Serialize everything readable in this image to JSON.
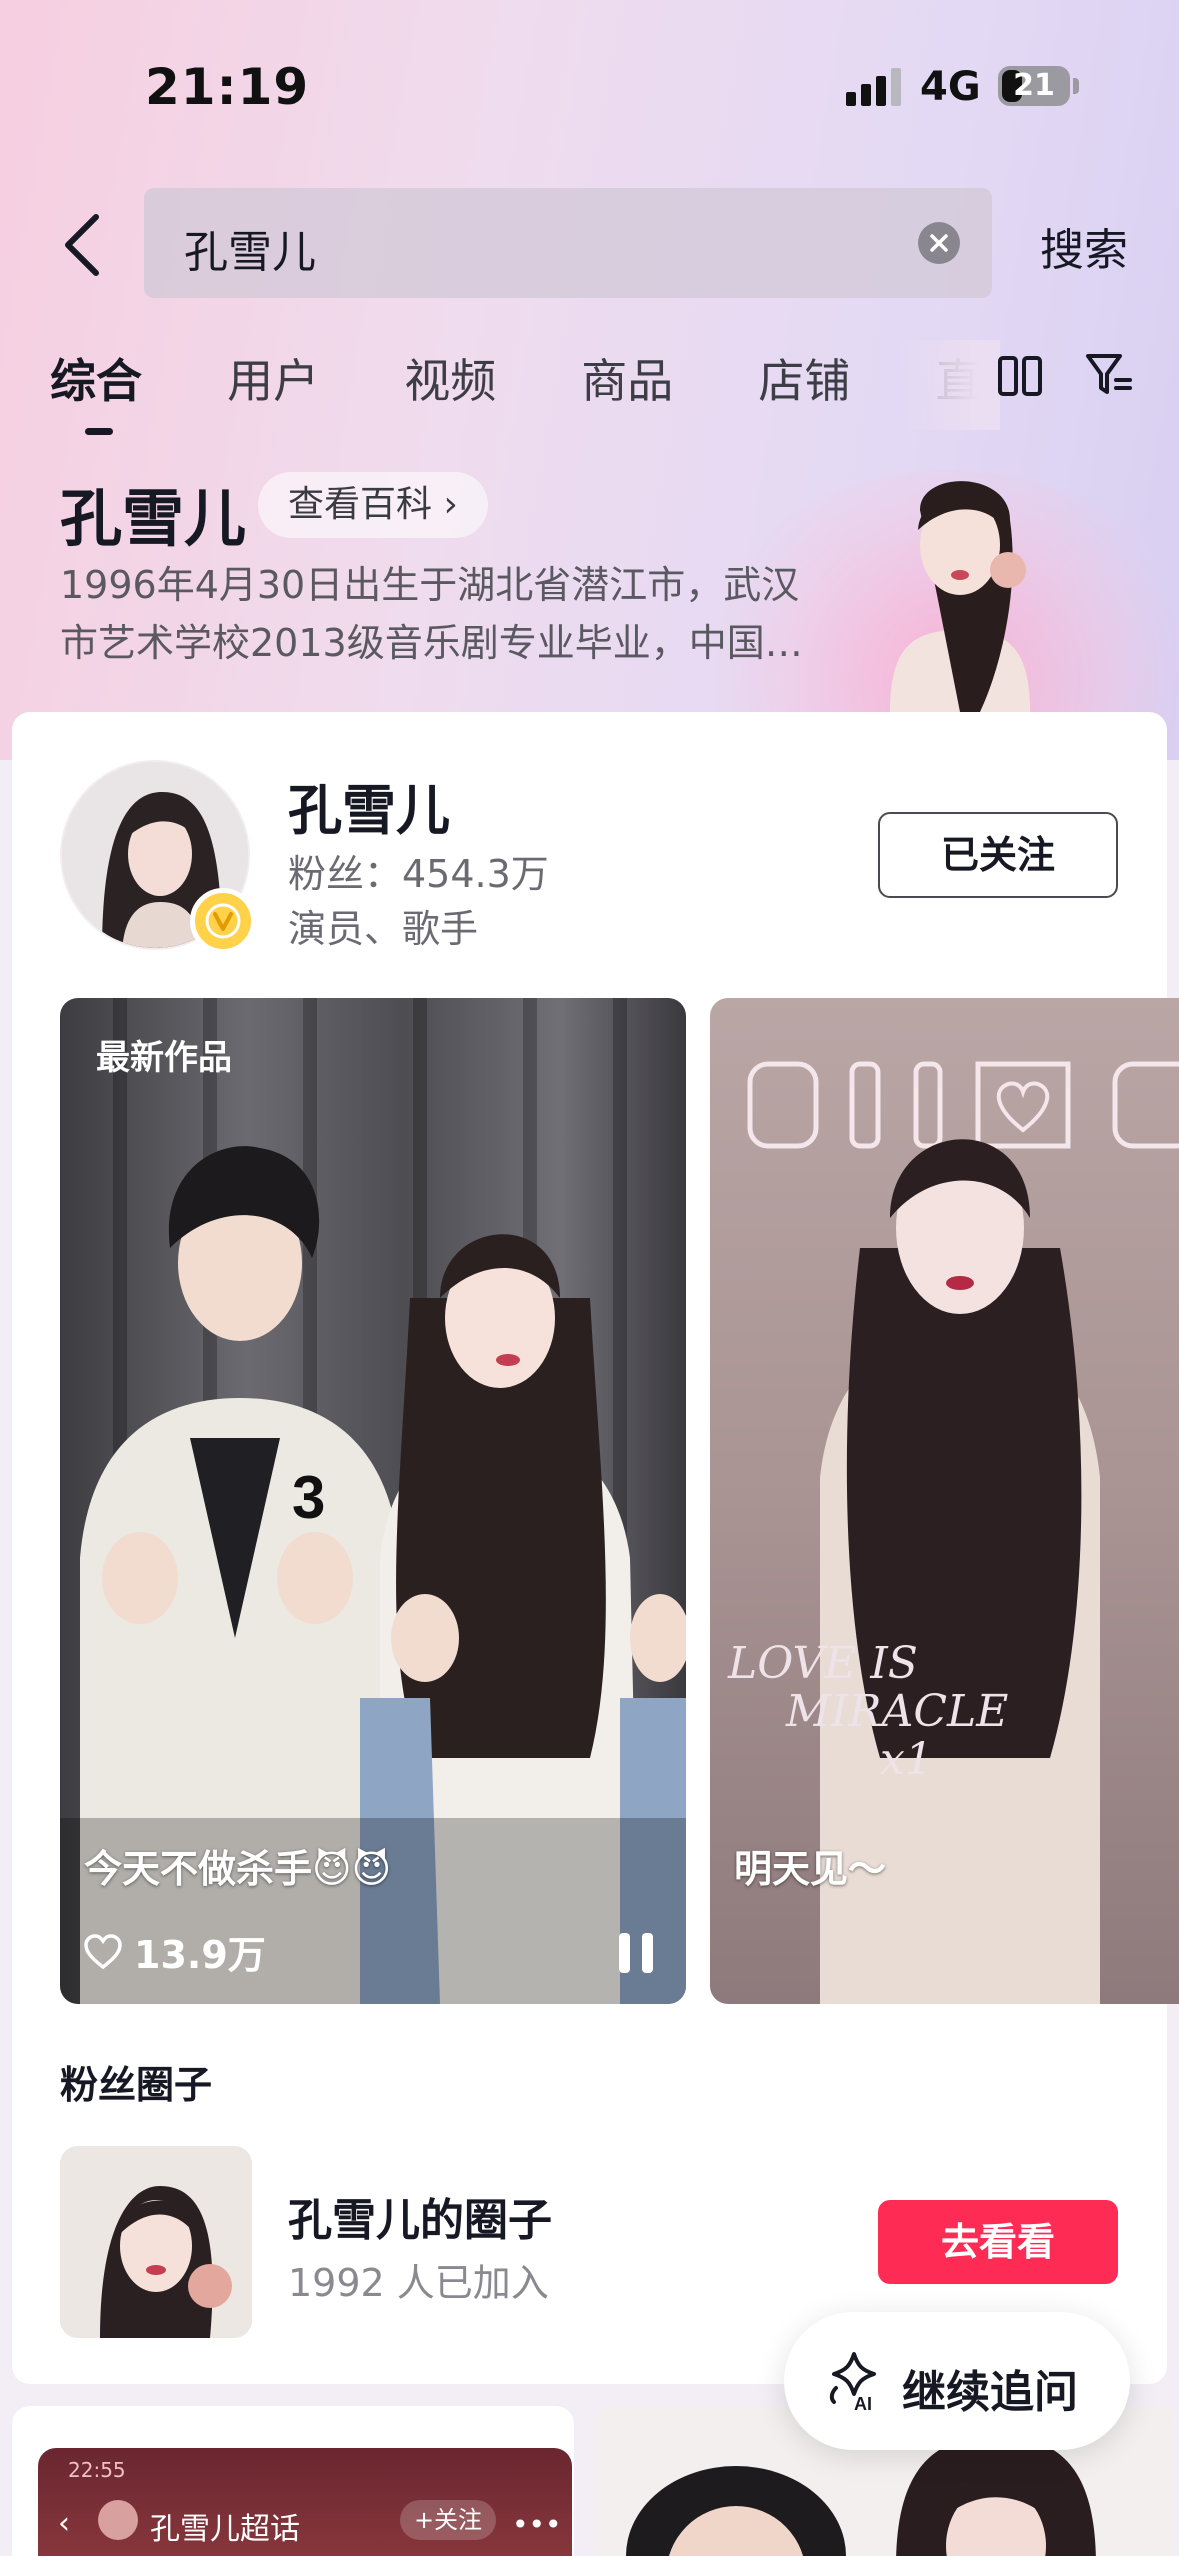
{
  "status_bar": {
    "time": "21:19",
    "network": "4G",
    "battery": "21"
  },
  "search": {
    "query": "孔雪儿",
    "button": "搜索"
  },
  "tabs": [
    {
      "label": "综合"
    },
    {
      "label": "用户"
    },
    {
      "label": "视频"
    },
    {
      "label": "商品"
    },
    {
      "label": "店铺"
    },
    {
      "label": "直播"
    }
  ],
  "baike": {
    "title": "孔雪儿",
    "button": "查看百科",
    "description": "1996年4月30日出生于湖北省潜江市，武汉市艺术学校2013级音乐剧专业毕业，中国…"
  },
  "user": {
    "name": "孔雪儿",
    "fans": "粉丝：454.3万",
    "tags": "演员、歌手",
    "follow_status": "已关注"
  },
  "videos": [
    {
      "label": "最新作品",
      "caption": "今天不做杀手😈😈",
      "likes": "13.9万"
    },
    {
      "caption": "明天见～",
      "overlay_text_1": "LOVE IS",
      "overlay_text_2": "MIRACLE",
      "overlay_text_3": "x1"
    }
  ],
  "fan_circle": {
    "section_title": "粉丝圈子",
    "name": "孔雪儿的圈子",
    "members": "1992 人已加入",
    "button": "去看看"
  },
  "bottom_card": {
    "time": "22:55",
    "title": "孔雪儿超话",
    "follow": "+关注"
  },
  "ai_button": {
    "label": "继续追问",
    "icon_label": "AI"
  },
  "colors": {
    "accent": "#fe2c55",
    "verify": "#ffd24a",
    "text": "#161823"
  }
}
